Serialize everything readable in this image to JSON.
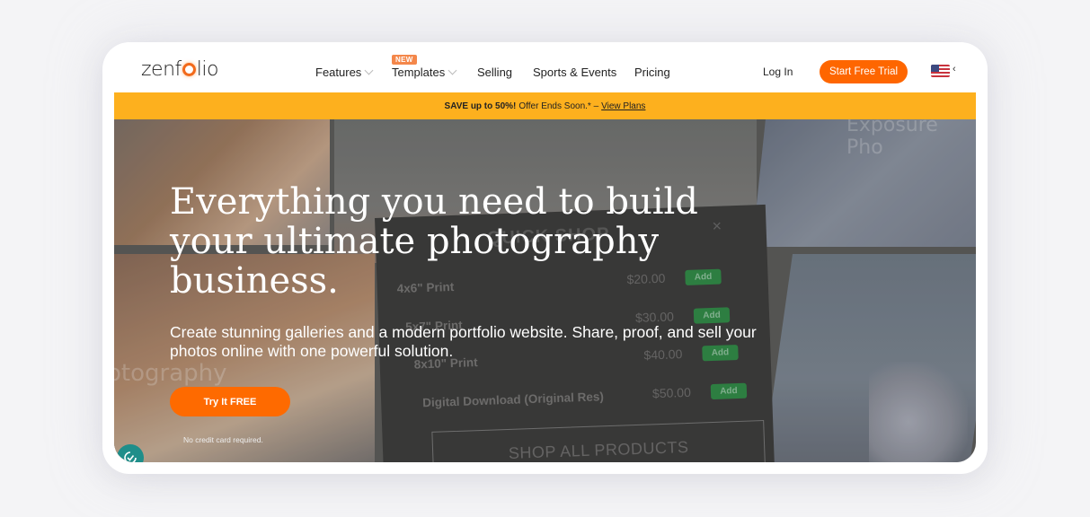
{
  "brand": {
    "logo_text_left": "zenf",
    "logo_text_right": "lio",
    "accent_color": "#fe6600",
    "promo_color": "#fdb01e"
  },
  "nav": {
    "items": [
      {
        "label": "Features",
        "has_dropdown": true
      },
      {
        "label": "Templates",
        "has_dropdown": true,
        "badge": "NEW"
      },
      {
        "label": "Selling",
        "has_dropdown": false
      },
      {
        "label": "Sports & Events",
        "has_dropdown": false
      },
      {
        "label": "Pricing",
        "has_dropdown": false
      }
    ],
    "login_label": "Log In",
    "trial_label": "Start Free Trial",
    "language_icon": "us-flag-icon",
    "language_chevron": "‹"
  },
  "promo": {
    "bold": "SAVE up to 50%!",
    "text": "Offer Ends Soon.* –",
    "link": "View Plans"
  },
  "hero": {
    "headline": "Everything you need to build your ultimate photography business.",
    "subhead": "Create stunning galleries and a modern portfolio website. Share, proof, and sell your photos online with one powerful solution.",
    "cta_label": "Try It FREE",
    "cta_note": "No credit card required.",
    "watermark_left": "otography",
    "watermark_top_right": "Exposure Pho"
  },
  "quick_shop": {
    "title": "QUICK SHOP",
    "close": "×",
    "items": [
      {
        "name": "4x6\" Print",
        "price": "$20.00",
        "action": "Add"
      },
      {
        "name": "5x7\" Print",
        "price": "$30.00",
        "action": "Add"
      },
      {
        "name": "8x10\" Print",
        "price": "$40.00",
        "action": "Add"
      },
      {
        "name": "Digital Download (Original Res)",
        "price": "$50.00",
        "action": "Add"
      }
    ],
    "shop_all": "SHOP ALL PRODUCTS"
  },
  "accessibility_icon": "accessibility-icon"
}
